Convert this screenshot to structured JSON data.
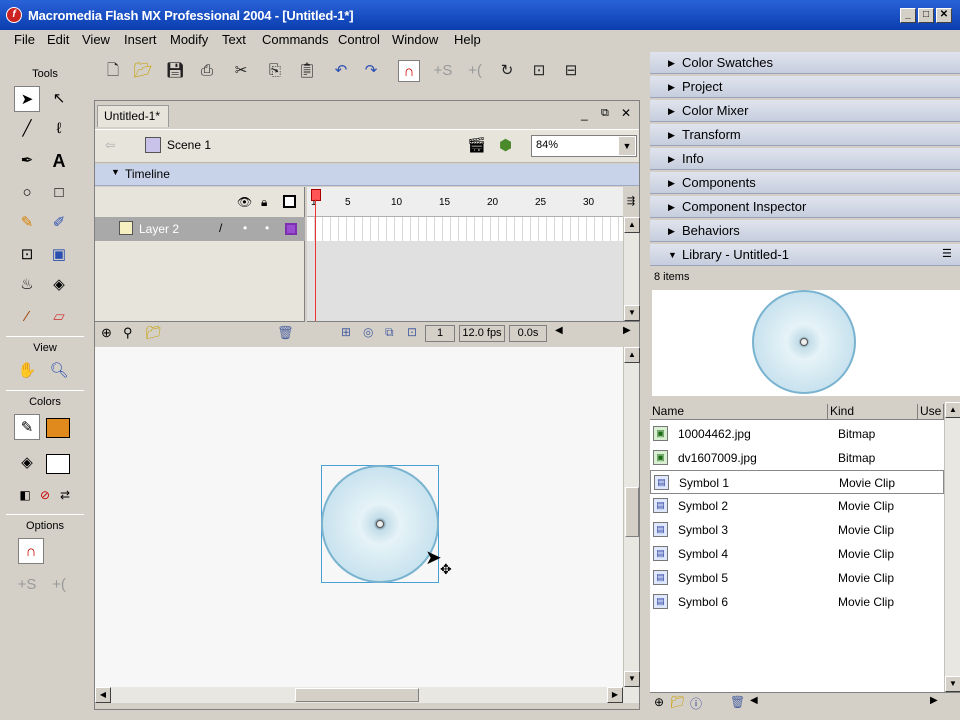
{
  "window": {
    "title": "Macromedia Flash MX Professional 2004 - [Untitled-1*]",
    "app_icon": "flash-icon",
    "minimize": "_",
    "maximize": "□",
    "close": "✕"
  },
  "menu": [
    "File",
    "Edit",
    "View",
    "Insert",
    "Modify",
    "Text",
    "Commands",
    "Control",
    "Window",
    "Help"
  ],
  "tools": {
    "title": "Tools",
    "view_label": "View",
    "colors_label": "Colors",
    "options_label": "Options",
    "stroke_color": "#000000",
    "fill_color": "#e08a1e"
  },
  "document": {
    "tab_label": "Untitled-1*",
    "scene_label": "Scene 1",
    "zoom": "84%",
    "timeline_label": "Timeline",
    "layer_name": "Layer 2",
    "ruler_ticks": [
      "1",
      "5",
      "10",
      "15",
      "20",
      "25",
      "30"
    ],
    "current_frame": "1",
    "fps": "12.0 fps",
    "elapsed": "0.0s"
  },
  "panels": [
    "Color Swatches",
    "Project",
    "Color Mixer",
    "Transform",
    "Info",
    "Components",
    "Component Inspector",
    "Behaviors"
  ],
  "library": {
    "title": "Library - Untitled-1",
    "count": "8 items",
    "col_name": "Name",
    "col_kind": "Kind",
    "col_use": "Use",
    "items": [
      {
        "name": "10004462.jpg",
        "kind": "Bitmap",
        "icon": "bitmap-icon"
      },
      {
        "name": "dv1607009.jpg",
        "kind": "Bitmap",
        "icon": "bitmap-icon"
      },
      {
        "name": "Symbol 1",
        "kind": "Movie Clip",
        "icon": "movie-clip-icon"
      },
      {
        "name": "Symbol 2",
        "kind": "Movie Clip",
        "icon": "movie-clip-icon"
      },
      {
        "name": "Symbol 3",
        "kind": "Movie Clip",
        "icon": "movie-clip-icon"
      },
      {
        "name": "Symbol 4",
        "kind": "Movie Clip",
        "icon": "movie-clip-icon"
      },
      {
        "name": "Symbol 5",
        "kind": "Movie Clip",
        "icon": "movie-clip-icon"
      },
      {
        "name": "Symbol 6",
        "kind": "Movie Clip",
        "icon": "movie-clip-icon"
      }
    ]
  }
}
